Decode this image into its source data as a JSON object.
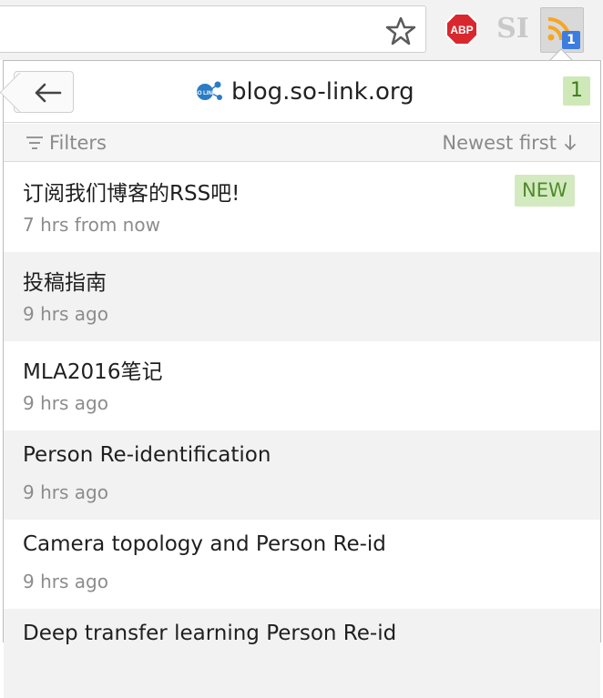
{
  "toolbar": {
    "bookmark_icon": "star-outline-icon",
    "adblock_label": "ABP",
    "extension_label": "SI",
    "rss_badge_count": "1"
  },
  "popup": {
    "back_icon": "arrow-left-icon",
    "site_title": "blog.so-link.org",
    "site_logo_text": "SO LINK",
    "unread_count": "1",
    "filters_label": "Filters",
    "sort_label": "Newest first",
    "items": [
      {
        "title": "订阅我们博客的RSS吧!",
        "time": "7 hrs from now",
        "badge": "NEW"
      },
      {
        "title": "投稿指南",
        "time": "9 hrs ago"
      },
      {
        "title": "MLA2016笔记",
        "time": "9 hrs ago"
      },
      {
        "title": "Person Re-identification",
        "time": "9 hrs ago"
      },
      {
        "title": "Camera topology and Person Re-id",
        "time": "9 hrs ago"
      },
      {
        "title": "Deep transfer learning Person Re-id",
        "time": ""
      }
    ]
  },
  "colors": {
    "rss_orange": "#f5a623",
    "abp_red": "#d9272e",
    "badge_blue": "#3d7de0",
    "new_green_bg": "#d3eac0",
    "new_green_text": "#4f8a2a"
  }
}
